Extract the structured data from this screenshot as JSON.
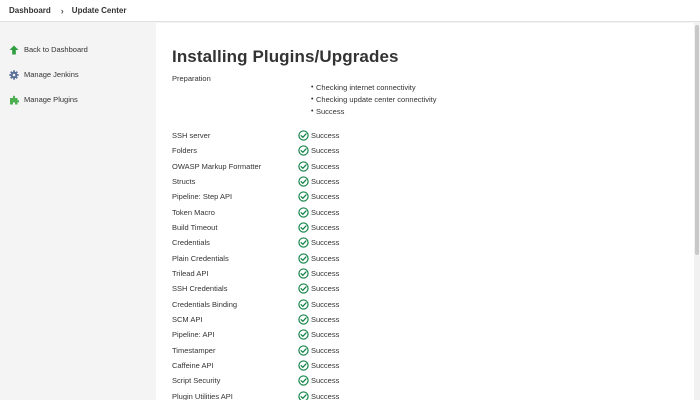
{
  "breadcrumb": {
    "items": [
      "Dashboard",
      "Update Center"
    ],
    "separator": "›"
  },
  "sidebar": {
    "items": [
      {
        "label": "Back to Dashboard",
        "icon": "up-arrow-icon"
      },
      {
        "label": "Manage Jenkins",
        "icon": "gear-icon"
      },
      {
        "label": "Manage Plugins",
        "icon": "puzzle-icon"
      }
    ]
  },
  "main": {
    "title": "Installing Plugins/Upgrades",
    "preparation": {
      "label": "Preparation",
      "steps": [
        "Checking internet connectivity",
        "Checking update center connectivity",
        "Success"
      ]
    },
    "plugins": [
      {
        "name": "SSH server",
        "status": "Success"
      },
      {
        "name": "Folders",
        "status": "Success"
      },
      {
        "name": "OWASP Markup Formatter",
        "status": "Success"
      },
      {
        "name": "Structs",
        "status": "Success"
      },
      {
        "name": "Pipeline: Step API",
        "status": "Success"
      },
      {
        "name": "Token Macro",
        "status": "Success"
      },
      {
        "name": "Build Timeout",
        "status": "Success"
      },
      {
        "name": "Credentials",
        "status": "Success"
      },
      {
        "name": "Plain Credentials",
        "status": "Success"
      },
      {
        "name": "Trilead API",
        "status": "Success"
      },
      {
        "name": "SSH Credentials",
        "status": "Success"
      },
      {
        "name": "Credentials Binding",
        "status": "Success"
      },
      {
        "name": "SCM API",
        "status": "Success"
      },
      {
        "name": "Pipeline: API",
        "status": "Success"
      },
      {
        "name": "Timestamper",
        "status": "Success"
      },
      {
        "name": "Caffeine API",
        "status": "Success"
      },
      {
        "name": "Script Security",
        "status": "Success"
      },
      {
        "name": "Plugin Utilities API",
        "status": "Success"
      }
    ]
  },
  "colors": {
    "success_green": "#138347",
    "back_arrow_green": "#2e9e3e",
    "gear_blue": "#5b6f9a",
    "puzzle_green": "#4caf50"
  }
}
